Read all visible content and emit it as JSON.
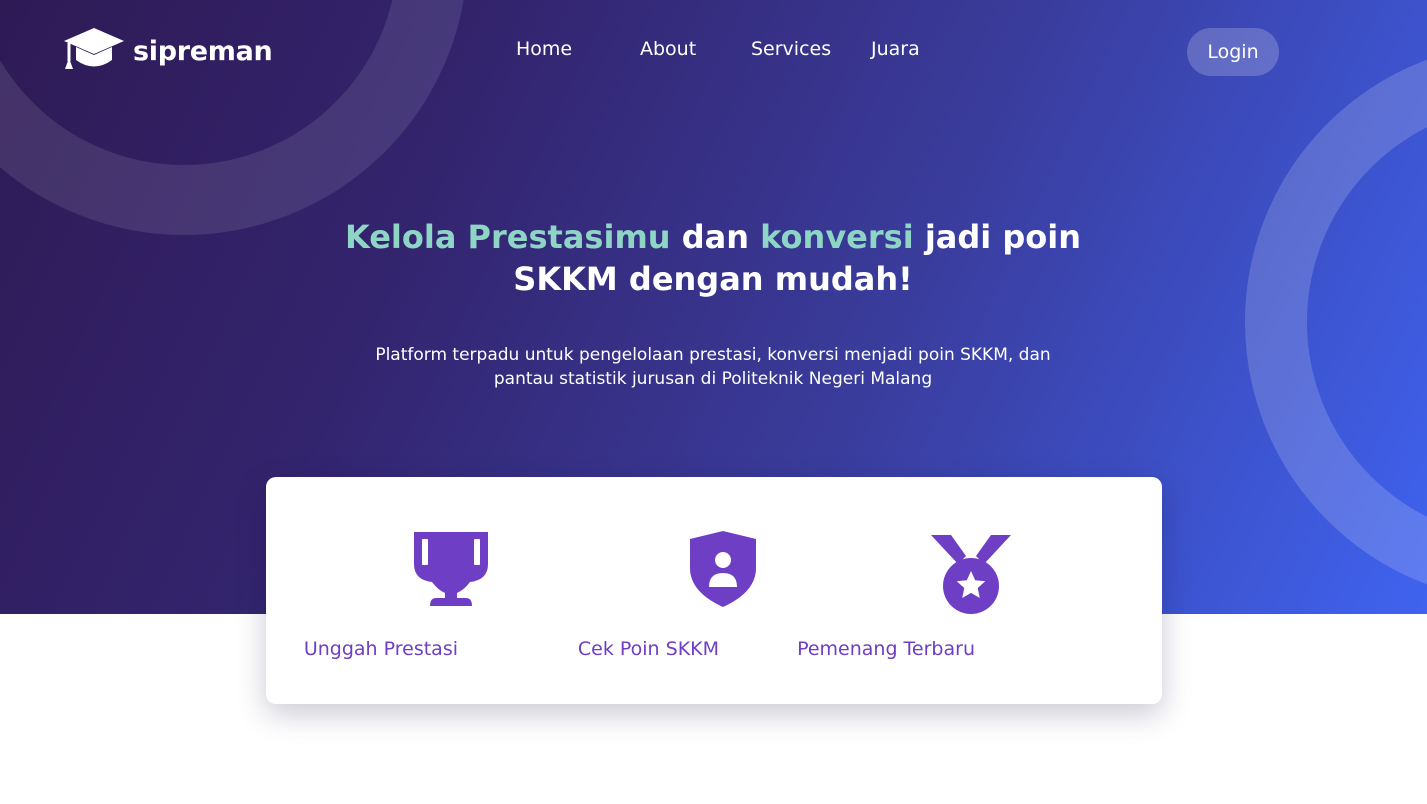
{
  "brand": {
    "name": "sipreman",
    "logo_icon": "graduation-cap-icon"
  },
  "nav": {
    "items": [
      {
        "label": "Home"
      },
      {
        "label": "About"
      },
      {
        "label": "Services"
      },
      {
        "label": "Juara"
      }
    ],
    "login_label": "Login"
  },
  "hero": {
    "headline": {
      "part1": "Kelola Prestasimu",
      "part2": " dan ",
      "part3": "konversi",
      "part4": " jadi poin SKKM dengan mudah!"
    },
    "subtext": "Platform terpadu untuk pengelolaan prestasi, konversi menjadi poin SKKM, dan pantau statistik jurusan di Politeknik Negeri Malang"
  },
  "features": [
    {
      "label": "Unggah Prestasi",
      "icon": "trophy-icon"
    },
    {
      "label": "Cek Poin SKKM",
      "icon": "user-shield-icon"
    },
    {
      "label": "Pemenang Terbaru",
      "icon": "medal-icon"
    }
  ],
  "colors": {
    "accent_green": "#8ed5c6",
    "icon_purple": "#6e3ec5",
    "gradient_start": "#2e1a55",
    "gradient_end": "#3f63f0"
  }
}
